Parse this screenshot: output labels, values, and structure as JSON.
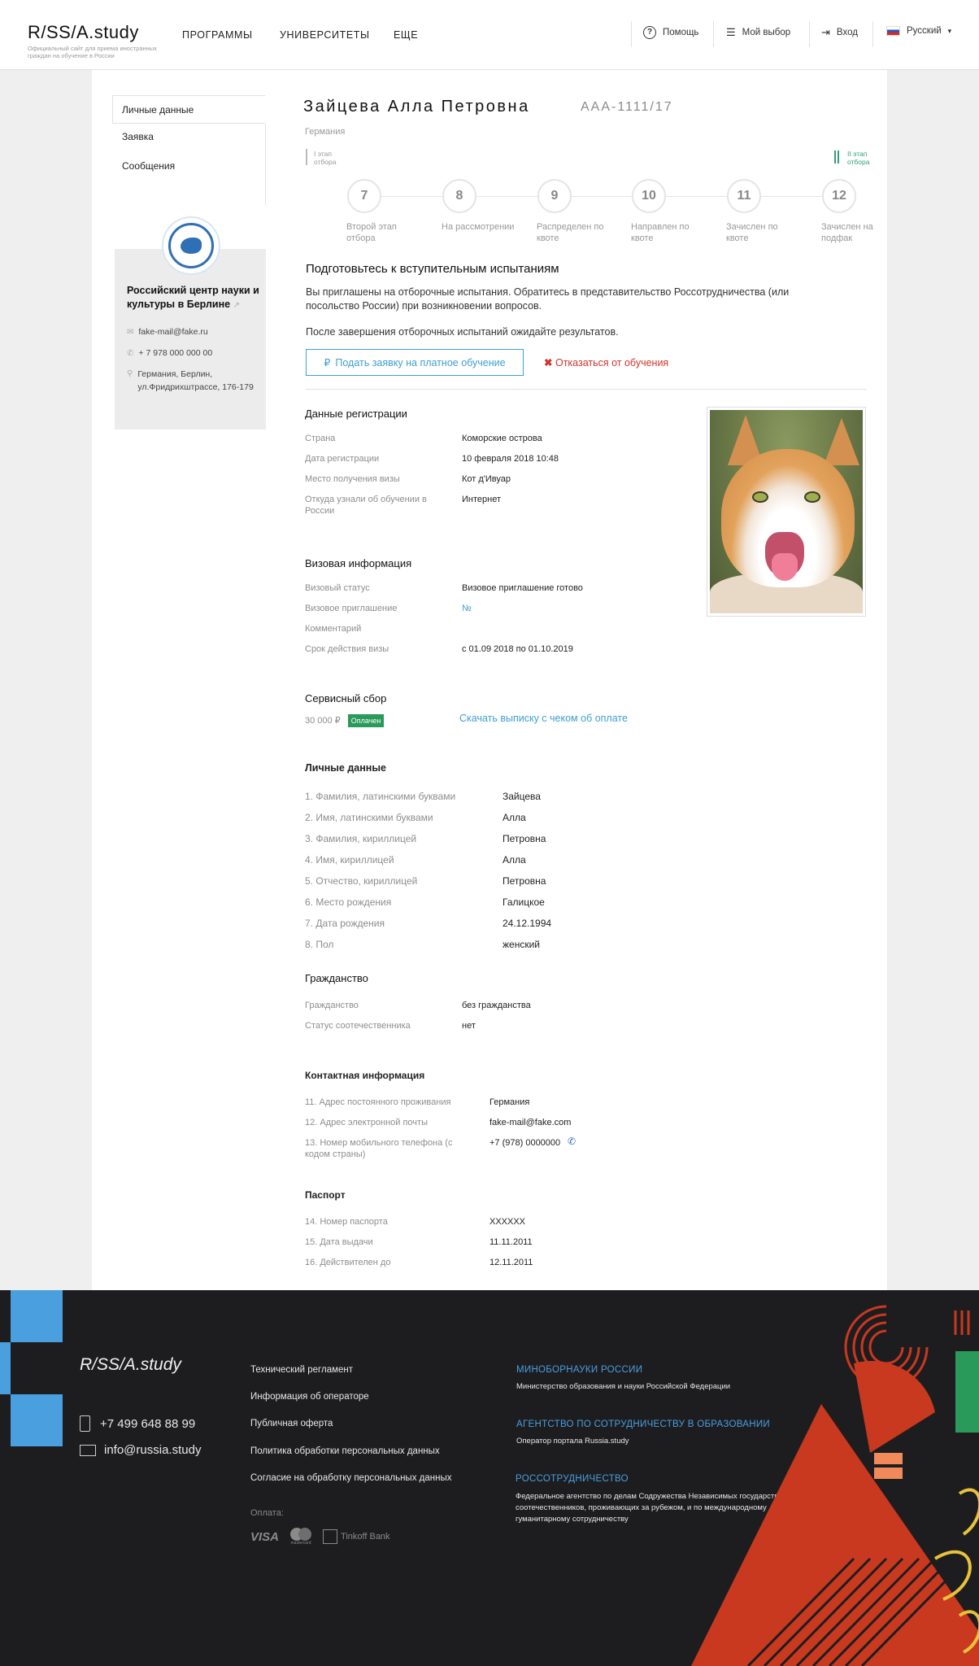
{
  "header": {
    "logo": "R/SS/A.study",
    "logo_subtitle": "Официальный сайт для приема иностранных граждан на обучение в России",
    "nav": [
      "ПРОГРАММЫ",
      "УНИВЕРСИТЕТЫ",
      "ЕЩЕ"
    ],
    "help": "Помощь",
    "my_choice": "Мой выбор",
    "login": "Вход",
    "language": "Русский"
  },
  "sidebar": {
    "items": [
      "Личные данные",
      "Заявка",
      "Сообщения"
    ],
    "org": {
      "name": "Российский центр науки и культуры в Берлине",
      "email": "fake-mail@fake.ru",
      "phone": "+ 7 978 000 000 00",
      "address": "Германия, Берлин, ул.Фридрихштрассе, 176-179"
    }
  },
  "profile": {
    "name": "Зайцева Алла Петровна",
    "code": "AAA-1111/17",
    "country": "Германия"
  },
  "stages": {
    "left_label": "I этап отбора",
    "right_label": "II этап отбора",
    "steps": [
      {
        "num": "7",
        "label": "Второй этап отбора"
      },
      {
        "num": "8",
        "label": "На рассмотрении"
      },
      {
        "num": "9",
        "label": "Распределен по квоте"
      },
      {
        "num": "10",
        "label": "Направлен по квоте"
      },
      {
        "num": "11",
        "label": "Зачислен по квоте"
      },
      {
        "num": "12",
        "label": "Зачислен на подфак"
      }
    ]
  },
  "notice": {
    "title": "Подготовьтесь к вступительным испытаниям",
    "text1": "Вы приглашены на отборочные испытания. Обратитесь в представительство Россотрудничества (или посольство России) при возникновении вопросов.",
    "text2": "После завершения отборочных испытаний ожидайте результатов.",
    "btn_paid": "Подать заявку на платное обучение",
    "btn_refuse": "Отказаться от обучения"
  },
  "registration": {
    "title": "Данные регистрации",
    "rows": [
      {
        "label": "Страна",
        "value": "Коморские острова"
      },
      {
        "label": "Дата регистрации",
        "value": "10 февраля 2018 10:48"
      },
      {
        "label": "Место получения визы",
        "value": "Кот д'Ивуар"
      },
      {
        "label": "Откуда узнали об обучении в России",
        "value": "Интернет"
      }
    ]
  },
  "visa": {
    "title": "Визовая информация",
    "rows": [
      {
        "label": "Визовый статус",
        "value": "Визовое приглашение готово"
      },
      {
        "label": "Визовое приглашение",
        "value": "№"
      },
      {
        "label": "Комментарий",
        "value": ""
      },
      {
        "label": "Срок действия визы",
        "value": "с 01.09 2018 по 01.10.2019"
      }
    ]
  },
  "fee": {
    "title": "Сервисный сбор",
    "amount": "30 000 ₽",
    "status": "Оплачен",
    "download": "Скачать выписку с чеком об оплате"
  },
  "personal": {
    "title": "Личные данные",
    "rows": [
      {
        "label": "1. Фамилия, латинскими буквами",
        "value": "Зайцева"
      },
      {
        "label": "2. Имя, латинскими буквами",
        "value": "Алла"
      },
      {
        "label": "3. Фамилия, кириллицей",
        "value": "Петровна"
      },
      {
        "label": "4. Имя, кириллицей",
        "value": "Алла"
      },
      {
        "label": "5. Отчество, кириллицей",
        "value": "Петровна"
      },
      {
        "label": "6. Место рождения",
        "value": "Галицкое"
      },
      {
        "label": "7. Дата рождения",
        "value": "24.12.1994"
      },
      {
        "label": "8. Пол",
        "value": "женский"
      }
    ]
  },
  "citizenship": {
    "title": "Гражданство",
    "rows": [
      {
        "label": "Гражданство",
        "value": "без гражданства"
      },
      {
        "label": "Статус соотечественника",
        "value": "нет"
      }
    ]
  },
  "contacts": {
    "title": "Контактная информация",
    "rows": [
      {
        "label": "11. Адрес постоянного проживания",
        "value": "Германия"
      },
      {
        "label": "12. Адрес электронной почты",
        "value": "fake-mail@fake.com"
      },
      {
        "label": "13. Номер мобильного телефона (с кодом страны)",
        "value": "+7 (978) 0000000"
      }
    ]
  },
  "passport": {
    "title": "Паспорт",
    "rows": [
      {
        "label": "14. Номер паспорта",
        "value": "XXXXXX"
      },
      {
        "label": "15. Дата выдачи",
        "value": "11.11.2011"
      },
      {
        "label": "16. Действителен до",
        "value": "12.11.2011"
      }
    ]
  },
  "footer": {
    "logo": "R/SS/A.study",
    "phone": "+7 499 648 88 99",
    "email": "info@russia.study",
    "links": [
      "Технический регламент",
      "Информация об операторе",
      "Публичная оферта",
      "Политика обработки персональных данных",
      "Согласие на обработку персональных данных"
    ],
    "payment_label": "Оплата:",
    "payment_methods": [
      "VISA",
      "mastercard",
      "Tinkoff Bank"
    ],
    "orgs": [
      {
        "title": "МИНОБОРНАУКИ РОССИИ",
        "text": "Министерство образования и науки Российской Федерации"
      },
      {
        "title": "АГЕНТСТВО ПО СОТРУДНИЧЕСТВУ В ОБРАЗОВАНИИ",
        "text": "Оператор портала Russia.study"
      },
      {
        "title": "РОССОТРУДНИЧЕСТВО",
        "text": "Федеральное агентство по делам Содружества Независимых государств, соотечественников, проживающих за рубежом, и по международному гуманитарному сотрудничеству"
      }
    ]
  },
  "colors": {
    "accent": "#3f9fd0",
    "danger": "#d0352b",
    "success": "#2a9a5b",
    "footer_bg": "#1d1d20",
    "footer_accent": "#4a9fde",
    "footer_red": "#c8391f"
  }
}
